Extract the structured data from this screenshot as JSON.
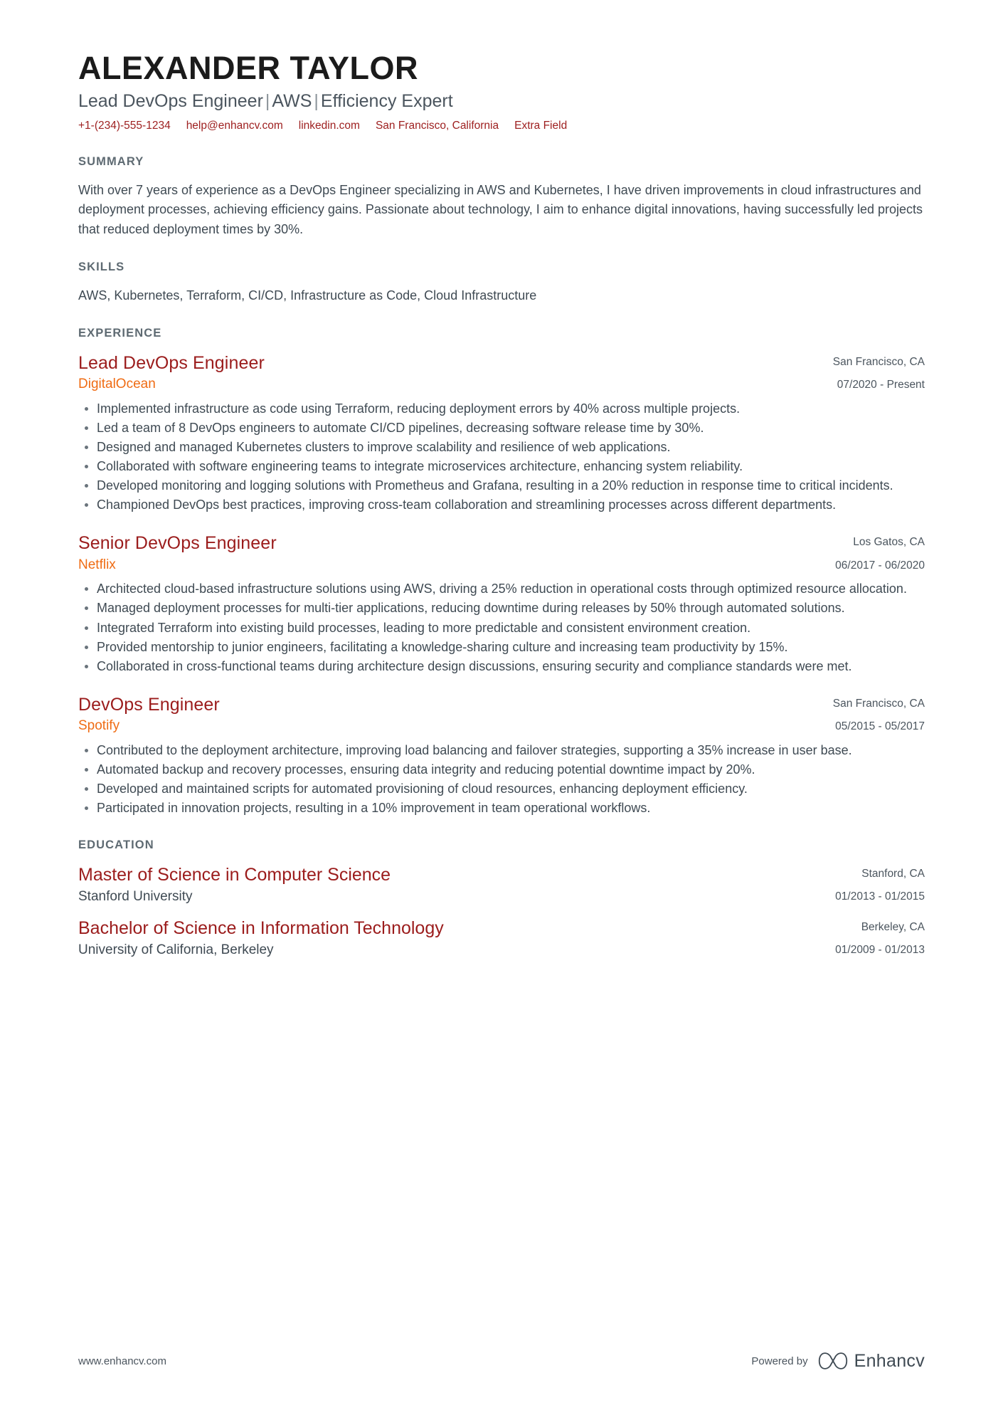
{
  "header": {
    "full_name": "ALEXANDER TAYLOR",
    "headline_parts": [
      "Lead DevOps Engineer",
      "AWS",
      "Efficiency Expert"
    ],
    "headline": "Lead DevOps Engineer | AWS | Efficiency Expert",
    "contacts": [
      "+1-(234)-555-1234",
      "help@enhancv.com",
      "linkedin.com",
      "San Francisco, California",
      "Extra Field"
    ]
  },
  "sections": {
    "summary": {
      "title": "SUMMARY",
      "text": "With over 7 years of experience as a DevOps Engineer specializing in AWS and Kubernetes, I have driven improvements in cloud infrastructures and deployment processes, achieving efficiency gains. Passionate about technology, I aim to enhance digital innovations, having successfully led projects that reduced deployment times by 30%."
    },
    "skills": {
      "title": "SKILLS",
      "text": "AWS, Kubernetes, Terraform, CI/CD, Infrastructure as Code, Cloud Infrastructure"
    },
    "experience": {
      "title": "EXPERIENCE",
      "items": [
        {
          "job_title": "Lead DevOps Engineer",
          "company": "DigitalOcean",
          "location": "San Francisco, CA",
          "dates": "07/2020 - Present",
          "bullets": [
            "Implemented infrastructure as code using Terraform, reducing deployment errors by 40% across multiple projects.",
            "Led a team of 8 DevOps engineers to automate CI/CD pipelines, decreasing software release time by 30%.",
            "Designed and managed Kubernetes clusters to improve scalability and resilience of web applications.",
            "Collaborated with software engineering teams to integrate microservices architecture, enhancing system reliability.",
            "Developed monitoring and logging solutions with Prometheus and Grafana, resulting in a 20% reduction in response time to critical incidents.",
            "Championed DevOps best practices, improving cross-team collaboration and streamlining processes across different departments."
          ]
        },
        {
          "job_title": "Senior DevOps Engineer",
          "company": "Netflix",
          "location": "Los Gatos, CA",
          "dates": "06/2017 - 06/2020",
          "bullets": [
            "Architected cloud-based infrastructure solutions using AWS, driving a 25% reduction in operational costs through optimized resource allocation.",
            "Managed deployment processes for multi-tier applications, reducing downtime during releases by 50% through automated solutions.",
            "Integrated Terraform into existing build processes, leading to more predictable and consistent environment creation.",
            "Provided mentorship to junior engineers, facilitating a knowledge-sharing culture and increasing team productivity by 15%.",
            "Collaborated in cross-functional teams during architecture design discussions, ensuring security and compliance standards were met."
          ]
        },
        {
          "job_title": "DevOps Engineer",
          "company": "Spotify",
          "location": "San Francisco, CA",
          "dates": "05/2015 - 05/2017",
          "bullets": [
            "Contributed to the deployment architecture, improving load balancing and failover strategies, supporting a 35% increase in user base.",
            "Automated backup and recovery processes, ensuring data integrity and reducing potential downtime impact by 20%.",
            "Developed and maintained scripts for automated provisioning of cloud resources, enhancing deployment efficiency.",
            "Participated in innovation projects, resulting in a 10% improvement in team operational workflows."
          ]
        }
      ]
    },
    "education": {
      "title": "EDUCATION",
      "items": [
        {
          "degree": "Master of Science in Computer Science",
          "school": "Stanford University",
          "location": "Stanford, CA",
          "dates": "01/2013 - 01/2015"
        },
        {
          "degree": "Bachelor of Science in Information Technology",
          "school": "University of California, Berkeley",
          "location": "Berkeley, CA",
          "dates": "01/2009 - 01/2013"
        }
      ]
    }
  },
  "footer": {
    "url": "www.enhancv.com",
    "powered_by": "Powered by",
    "brand": "Enhancv"
  },
  "colors": {
    "title_red": "#9b1c1c",
    "company_orange": "#ef6c14",
    "contact_red": "#9e2020",
    "section_gray": "#5e6a72",
    "body_gray": "#3f4a53"
  }
}
